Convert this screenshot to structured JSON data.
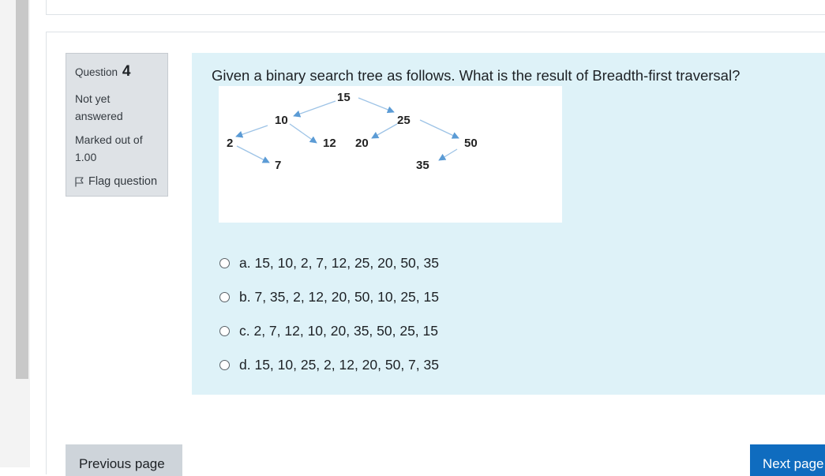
{
  "question": {
    "label": "Question",
    "number": "4",
    "state_line1": "Not yet",
    "state_line2": "answered",
    "grade_line1": "Marked out of",
    "grade_line2": "1.00",
    "flag_label": "Flag question",
    "text": "Given a binary search tree as follows. What is the result of Breadth-first traversal?"
  },
  "tree": {
    "nodes": [
      "15",
      "10",
      "25",
      "2",
      "12",
      "20",
      "50",
      "7",
      "35"
    ]
  },
  "answers": [
    {
      "label": "a. 15, 10, 2, 7, 12, 25, 20, 50, 35"
    },
    {
      "label": "b. 7, 35, 2, 12, 20, 50, 10, 25, 15"
    },
    {
      "label": "c. 2, 7, 12, 10, 20, 35, 50, 25, 15"
    },
    {
      "label": "d. 15, 10, 25, 2, 12, 20, 50, 7, 35"
    }
  ],
  "nav": {
    "prev_label": "Previous page",
    "next_label": "Next page"
  },
  "colors": {
    "content_bg": "#def2f8",
    "info_bg": "#dee2e6",
    "primary": "#0f6cbf",
    "edge": "#5b9bd5"
  },
  "icons": {
    "flag": "flag-outline-icon",
    "answer": "radio-unchecked-icon"
  }
}
